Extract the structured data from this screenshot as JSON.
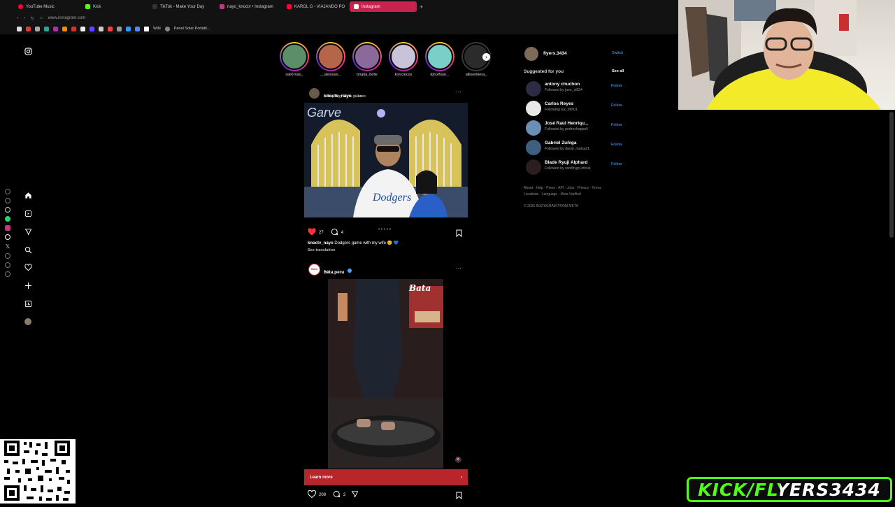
{
  "browser": {
    "tabs": [
      {
        "label": "YouTube Music",
        "color": "#ff0033"
      },
      {
        "label": "Kick",
        "color": "#53fc18"
      },
      {
        "label": "TikTok - Make Your Day",
        "color": "#222222"
      },
      {
        "label": "nayo_knoctv • Instagram",
        "color": "#c13584"
      },
      {
        "label": "KAROL G - VIAJANDO PO",
        "color": "#ff0033"
      },
      {
        "label": "Instagram",
        "color": "#c13584",
        "active": true
      }
    ],
    "new_tab": "+",
    "url": "www.instagram.com",
    "bookmarks": [
      "WIN",
      "Panel Solar Portátil..."
    ]
  },
  "stories": [
    {
      "name": "sailornao_",
      "color": "#5b8f6a"
    },
    {
      "name": "__alessias...",
      "color": "#b5654a"
    },
    {
      "name": "brujita_belle",
      "color": "#8a6a9a"
    },
    {
      "name": "koryzecos",
      "color": "#c9c3d9"
    },
    {
      "name": "djnotfoun...",
      "color": "#7ad0c8"
    },
    {
      "name": "allisonkiera_",
      "color": "#3a3a3a",
      "seen": true
    }
  ],
  "post1": {
    "user": "knoctv_nayo",
    "time": "1w",
    "subtitle": "Ray-Ban Meta glasses",
    "likes": "27",
    "comments": "4",
    "caption_user": "knoctv_nayo",
    "caption": "Dodgers game with my wife 😊 💙",
    "see_translation": "See translation",
    "more": "···"
  },
  "post2": {
    "user": "bata.peru",
    "subtitle": "Ad",
    "brand": "Bata",
    "cta": "Learn more",
    "likes": "208",
    "comments": "2",
    "more": "···"
  },
  "rail": {
    "me": "flyers.3434",
    "switch": "Switch",
    "suggested_title": "Suggested for you",
    "see_all": "See all",
    "suggestions": [
      {
        "name": "antony chuchon",
        "sub": "Followed by jose_vi824",
        "follow": "Follow",
        "color": "#2b2b44"
      },
      {
        "name": "Carlos Reyes",
        "sub": "Following luz_l9th01",
        "follow": "Follow",
        "color": "#e8e8e8"
      },
      {
        "name": "José Raúl Henriqu...",
        "sub": "Followed by pedrochappell",
        "follow": "Follow",
        "color": "#6a8fb5"
      },
      {
        "name": "Gabriel Zuñiga",
        "sub": "Followed by david_malca21",
        "follow": "Follow",
        "color": "#3f5f7f"
      },
      {
        "name": "Blade Ryuji Alphard",
        "sub": "Followed by randhygo.oficial",
        "follow": "Follow",
        "color": "#2a1e1e"
      }
    ],
    "footer1": "About · Help · Press · API · Jobs · Privacy · Terms ·",
    "footer2": "Locations · Language · Meta Verified",
    "copyright": "© 2026 INSTAGRAM FROM META"
  },
  "overlay": {
    "kick_handle": "KICK/FLYERS3434"
  }
}
